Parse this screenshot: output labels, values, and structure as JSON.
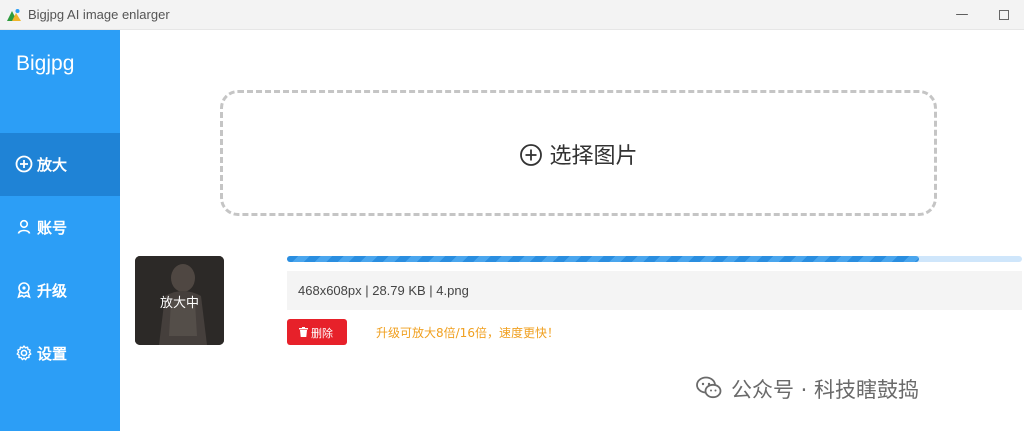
{
  "window": {
    "title": "Bigjpg AI image enlarger",
    "minimize_glyph": "—",
    "icons": {
      "app": "app-logo-icon",
      "maximize": "maximize-icon"
    }
  },
  "sidebar": {
    "brand": "Bigjpg",
    "items": [
      {
        "label": "放大",
        "icon": "plus-circle-icon",
        "active": true
      },
      {
        "label": "账号",
        "icon": "user-icon",
        "active": false
      },
      {
        "label": "升级",
        "icon": "crown-icon",
        "active": false
      },
      {
        "label": "设置",
        "icon": "gear-icon",
        "active": false
      }
    ]
  },
  "upload": {
    "label": "选择图片",
    "icon": "plus-circle-icon"
  },
  "task": {
    "thumbnail_status": "放大中",
    "progress": 0.86,
    "info": "468x608px | 28.79 KB | 4.png",
    "delete_label": "删除",
    "delete_icon": "trash-icon",
    "upgrade_tip": "升级可放大8倍/16倍，速度更快！"
  },
  "watermark": {
    "text": "公众号 · 科技瞎鼓捣",
    "icon": "wechat-icon"
  },
  "colors": {
    "sidebar": "#2c9ef6",
    "sidebar_active": "#1f83d6",
    "delete": "#e7212a",
    "tip": "#f0a020",
    "progress": "#2a8ee0"
  }
}
